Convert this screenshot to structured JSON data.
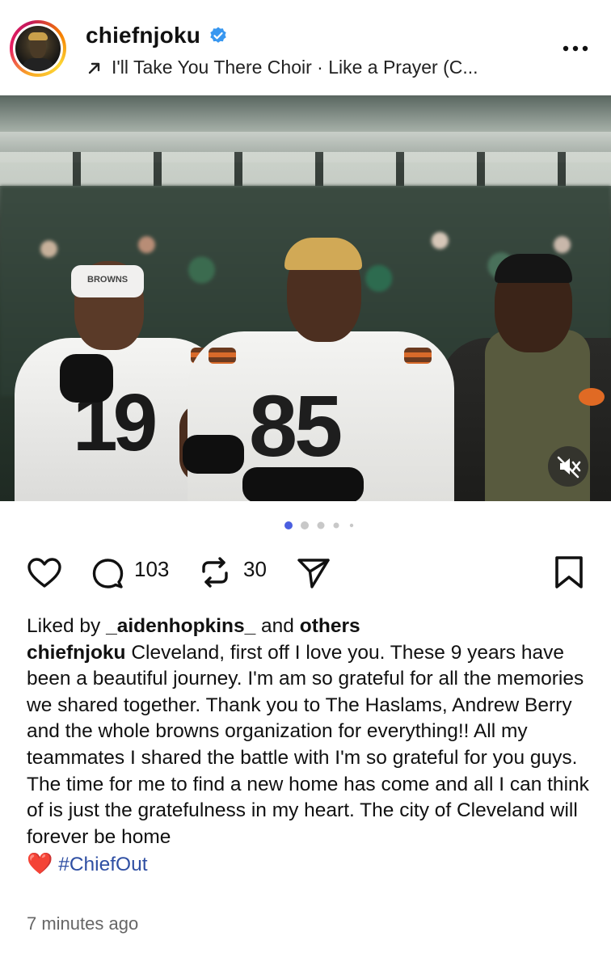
{
  "header": {
    "username": "chiefnjoku",
    "verified": true,
    "music_text": "I'll Take You There Choir · Like a Prayer (C..."
  },
  "post": {
    "jersey_numbers": [
      "19",
      "85"
    ],
    "headband_text": "BROWNS",
    "carousel": {
      "count": 5,
      "active": 0
    },
    "audio": "muted"
  },
  "actions": {
    "comments_count": "103",
    "reposts_count": "30"
  },
  "caption": {
    "liked_prefix": "Liked by ",
    "liked_user": "_aidenhopkins_",
    "liked_and": " and ",
    "liked_others": "others",
    "author": "chiefnjoku",
    "text": " Cleveland, first off I love you. These 9 years have been a beautiful journey. I'm am so grateful for all the memories we shared together. Thank you to The Haslams, Andrew Berry and the whole browns organization for everything!! All my teammates I shared the battle with I'm so grateful for you guys. The time for me to find a new home has come and all I can think of is just the gratefulness in my heart. The city of Cleveland will forever be home",
    "emoji": "❤️",
    "hashtag": "#ChiefOut"
  },
  "timestamp": "7 minutes ago",
  "colors": {
    "verified_blue": "#3897f0",
    "hashtag_blue": "#2f4fa3",
    "active_dot": "#4a5fe0"
  }
}
